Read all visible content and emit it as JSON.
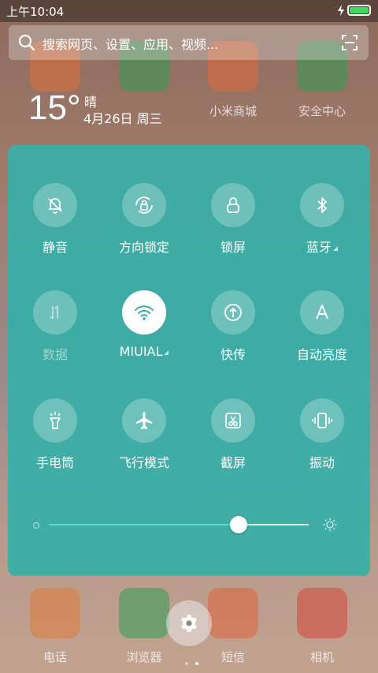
{
  "status_bar": {
    "time": "上午10:04",
    "battery_color": "#40d95c"
  },
  "search": {
    "placeholder": "搜索网页、设置、应用、视频..."
  },
  "weather": {
    "temperature": "15°",
    "condition": "晴",
    "date": "4月26日 周三"
  },
  "background_apps": [
    {
      "label": "电话",
      "color": "#e07a3a"
    },
    {
      "label": "浏览器",
      "color": "#2f9c55"
    },
    {
      "label": "短信",
      "color": "#e0603a"
    },
    {
      "label": "相机",
      "color": "#d6453a"
    },
    {
      "label": "小米商城",
      "color": "#e06a3a"
    },
    {
      "label": "安全中心",
      "color": "#2f9c55"
    },
    {
      "label": "15",
      "color": "#e0703a"
    }
  ],
  "toggles": [
    {
      "label": "静音",
      "icon": "bell-off-icon",
      "active": false
    },
    {
      "label": "方向锁定",
      "icon": "rotation-lock-icon",
      "active": false
    },
    {
      "label": "锁屏",
      "icon": "lock-icon",
      "active": false
    },
    {
      "label": "蓝牙",
      "icon": "bluetooth-icon",
      "active": false,
      "expandable": true
    },
    {
      "label": "数据",
      "icon": "mobile-data-icon",
      "active": false,
      "disabled": true
    },
    {
      "label": "MIUIAL",
      "icon": "wifi-icon",
      "active": true,
      "expandable": true
    },
    {
      "label": "快传",
      "icon": "share-upload-icon",
      "active": false
    },
    {
      "label": "自动亮度",
      "icon": "auto-brightness-icon",
      "active": false
    },
    {
      "label": "手电筒",
      "icon": "flashlight-icon",
      "active": false
    },
    {
      "label": "飞行模式",
      "icon": "airplane-icon",
      "active": false
    },
    {
      "label": "截屏",
      "icon": "screenshot-scissors-icon",
      "active": false
    },
    {
      "label": "振动",
      "icon": "vibrate-icon",
      "active": false
    }
  ],
  "brightness": {
    "level": 0.73,
    "fill_color": "#4de0cf"
  },
  "panel_color": "#34b0a8",
  "pagination": {
    "current": 2,
    "total": 2
  }
}
